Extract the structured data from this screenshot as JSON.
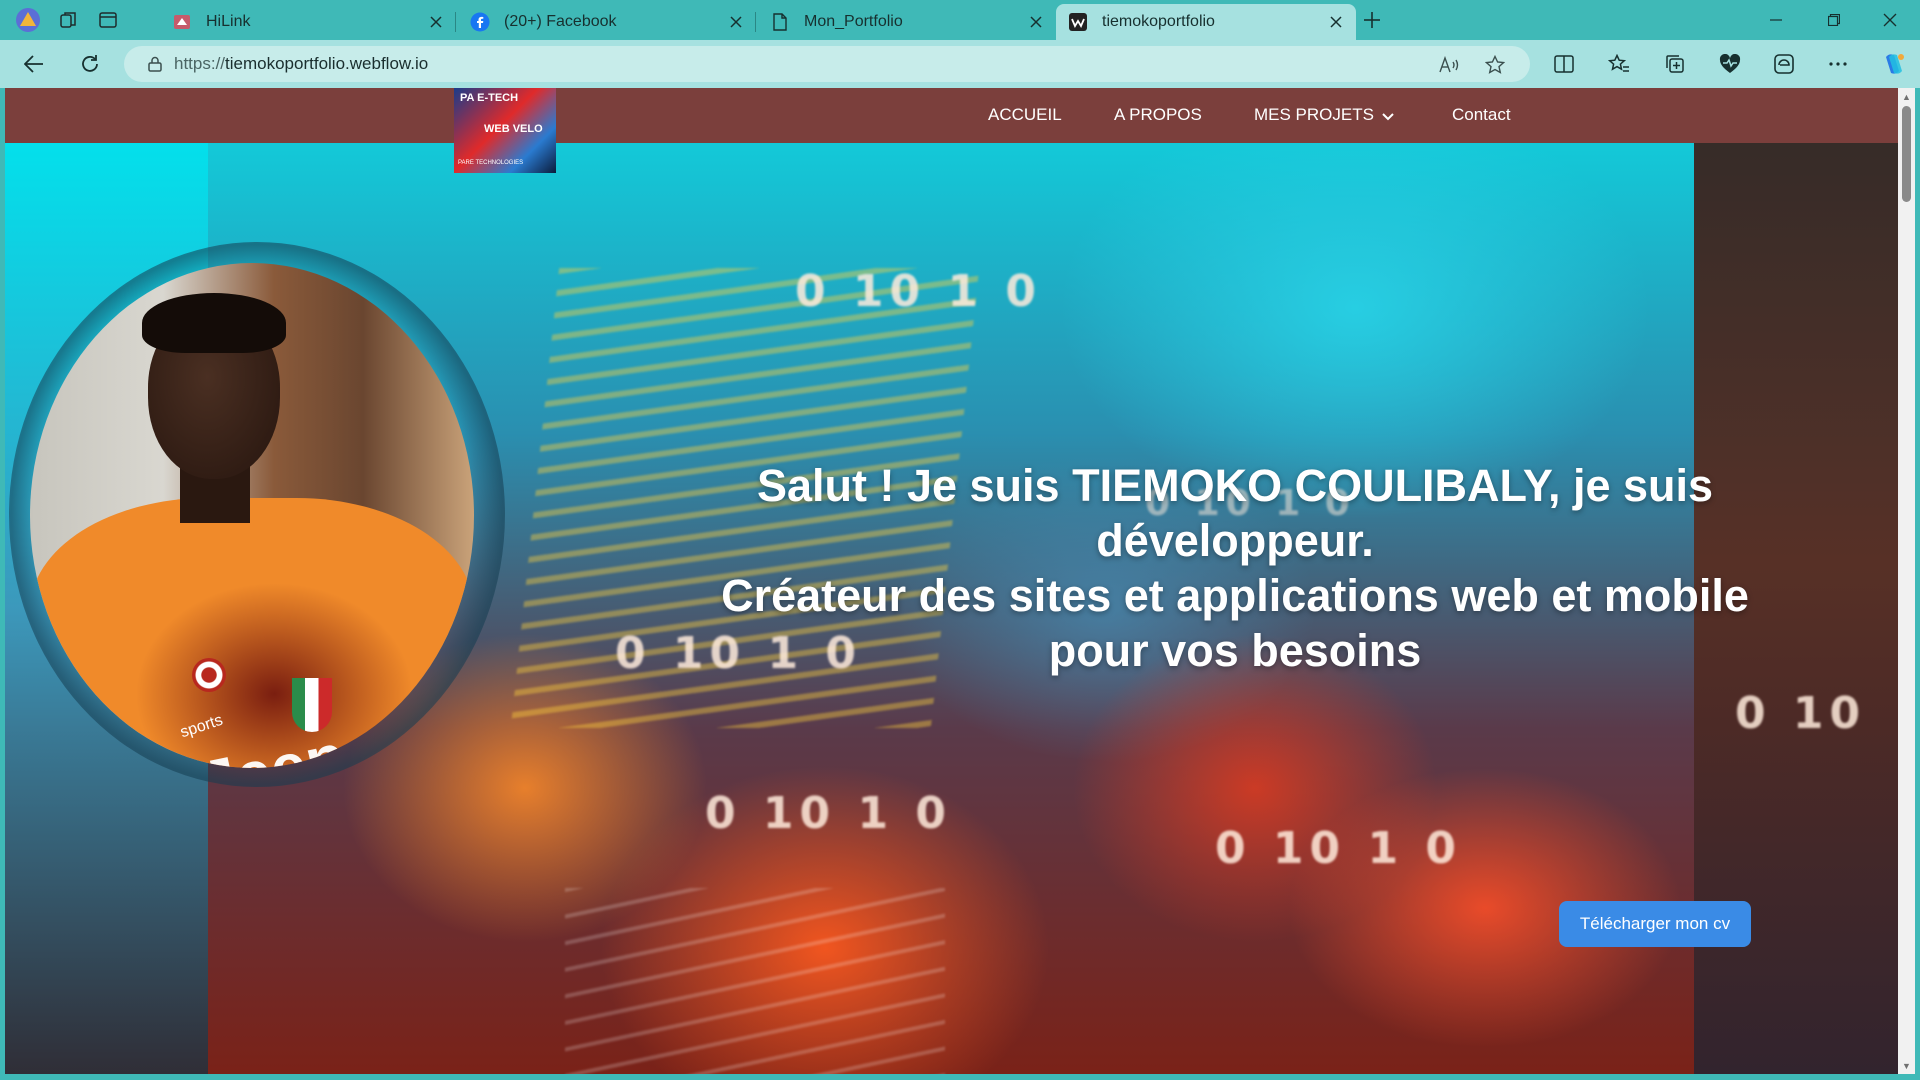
{
  "browser": {
    "tabs": [
      {
        "title": "HiLink",
        "icon": "hilink-favicon"
      },
      {
        "title": "(20+) Facebook",
        "icon": "facebook-favicon"
      },
      {
        "title": "Mon_Portfolio",
        "icon": "document-favicon"
      },
      {
        "title": "tiemokoportfolio",
        "icon": "webflow-favicon",
        "active": true
      }
    ],
    "url_protocol": "https://",
    "url_host": "tiemokoportfolio.webflow.io"
  },
  "site": {
    "logo": {
      "line1": "PA E-TECH",
      "line2": "WEB VELO",
      "line3": "PARE TECHNOLOGIES"
    },
    "nav": [
      {
        "label": "ACCUEIL"
      },
      {
        "label": "A PROPOS"
      },
      {
        "label": "MES PROJETS"
      },
      {
        "label": "Contact"
      }
    ],
    "hero": {
      "line1": "Salut ! Je suis TIEMOKO COULIBALY, je suis développeur.",
      "line2": "Créateur des sites et applications web et mobile pour vos besoins",
      "cv_button": "Télécharger mon cv"
    },
    "background_digits": [
      "0 10 1 0",
      "0 10 1 0",
      "0 10 1 0",
      "0 10 1 0",
      "0 10",
      "0 10 1 0"
    ],
    "avatar_shirt_text": {
      "brand": "Jeep",
      "sub": "sports"
    }
  },
  "colors": {
    "chrome": "#3fb9b7",
    "addressbar": "#a6e1e0",
    "navbar": "#7b3f3c",
    "button": "#3a8be6"
  }
}
